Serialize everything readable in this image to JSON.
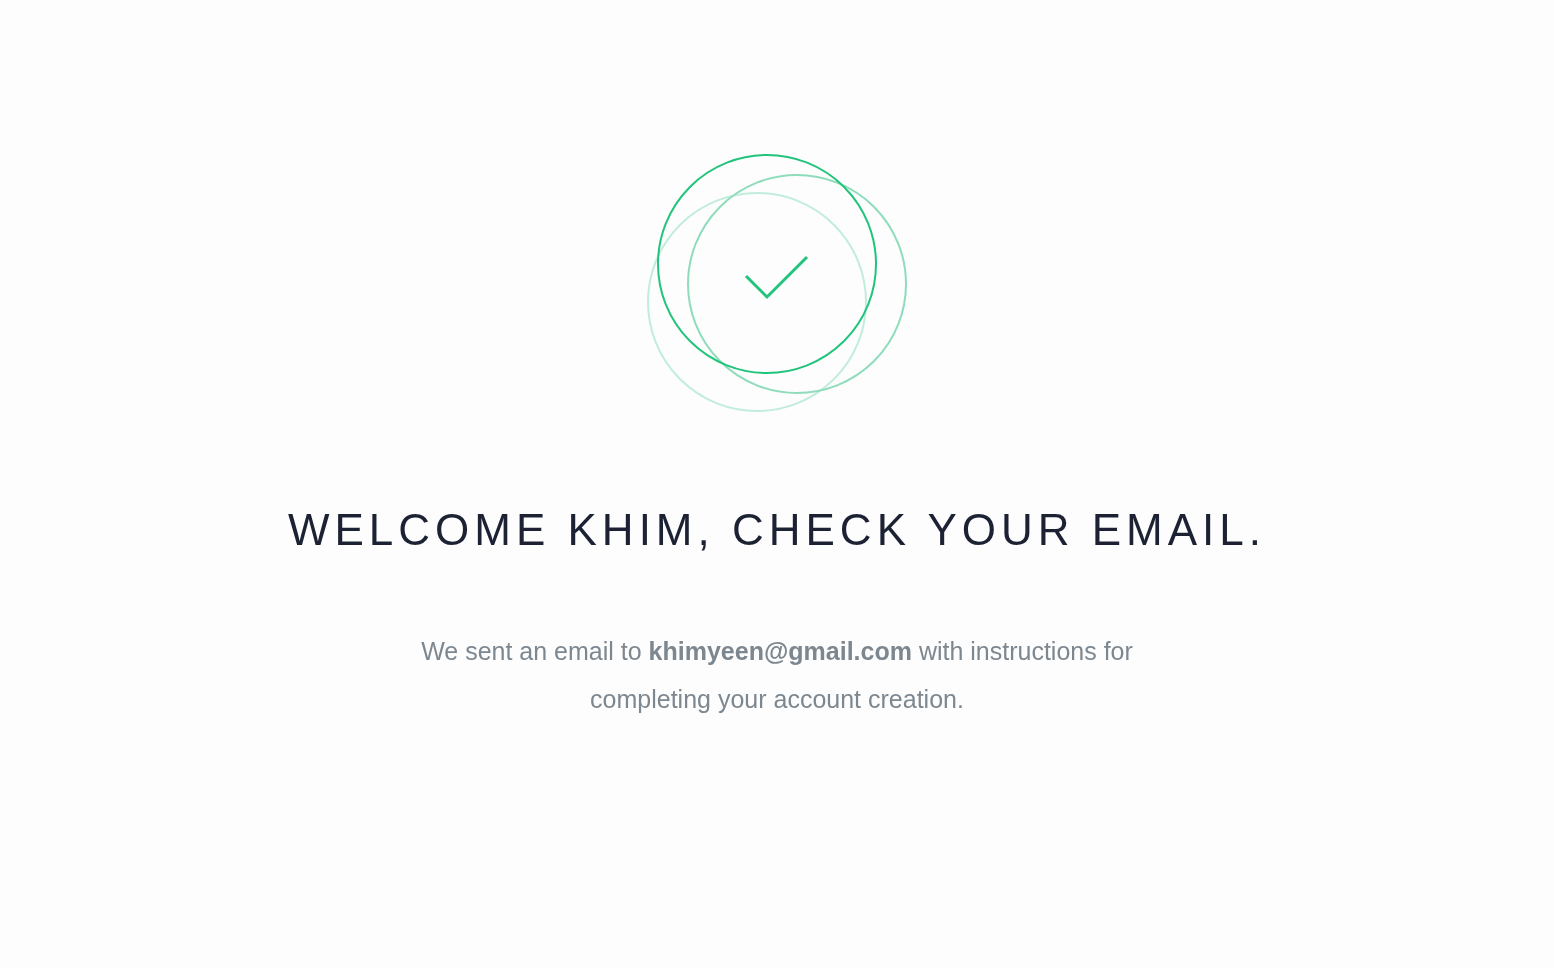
{
  "heading": "WELCOME KHIM, CHECK YOUR EMAIL.",
  "message": "We sent an email to **khimyeen@gmail.com** with instructions for completing your account creation."
}
